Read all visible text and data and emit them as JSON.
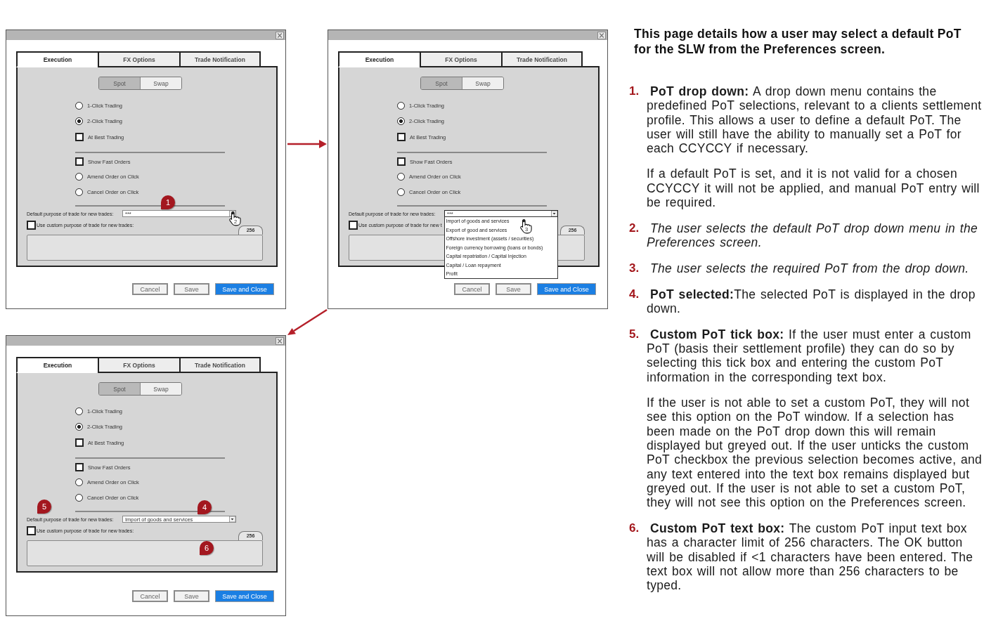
{
  "dialogs": [
    {
      "tabs": [
        {
          "label": "Execution",
          "selected": true
        },
        {
          "label": "FX Options",
          "selected": false
        },
        {
          "label": "Trade Notification",
          "selected": false
        }
      ],
      "segments": [
        {
          "label": "Spot",
          "selected": true
        },
        {
          "label": "Swap",
          "selected": false
        }
      ],
      "option_groups": [
        [
          {
            "kind": "radio",
            "label": "1-Click Trading",
            "checked": false
          },
          {
            "kind": "radio",
            "label": "2-Click Trading",
            "checked": true
          },
          {
            "kind": "checkbox",
            "label": "At Best Trading",
            "checked": false
          }
        ],
        [
          {
            "kind": "checkbox",
            "label": "Show Fast Orders",
            "checked": false
          },
          {
            "kind": "radio",
            "label": "Amend Order on Click",
            "checked": false
          },
          {
            "kind": "radio",
            "label": "Cancel Order on Click",
            "checked": false
          }
        ]
      ],
      "purpose": {
        "label": "Default purpose of trade for new trades:",
        "value": "***",
        "open": false
      },
      "custom": {
        "label": "Use custom purpose of trade for new trades:",
        "checked": false
      },
      "counter": "256",
      "buttons": [
        {
          "label": "Cancel",
          "kind": "secondary"
        },
        {
          "label": "Save",
          "kind": "secondary"
        },
        {
          "label": "Save and Close",
          "kind": "primary"
        }
      ],
      "markers": [
        "1"
      ],
      "cursor_step": "2"
    },
    {
      "tabs": [
        {
          "label": "Execution",
          "selected": true
        },
        {
          "label": "FX Options",
          "selected": false
        },
        {
          "label": "Trade Notification",
          "selected": false
        }
      ],
      "segments": [
        {
          "label": "Spot",
          "selected": true
        },
        {
          "label": "Swap",
          "selected": false
        }
      ],
      "option_groups": [
        [
          {
            "kind": "radio",
            "label": "1-Click Trading",
            "checked": false
          },
          {
            "kind": "radio",
            "label": "2-Click Trading",
            "checked": true
          },
          {
            "kind": "checkbox",
            "label": "At Best Trading",
            "checked": false
          }
        ],
        [
          {
            "kind": "checkbox",
            "label": "Show Fast Orders",
            "checked": false
          },
          {
            "kind": "radio",
            "label": "Amend Order on Click",
            "checked": false
          },
          {
            "kind": "radio",
            "label": "Cancel Order on Click",
            "checked": false
          }
        ]
      ],
      "purpose": {
        "label": "Default purpose of trade for new trades:",
        "value": "***",
        "open": true,
        "menu": [
          {
            "label": "Import of goods and services",
            "selected": false
          },
          {
            "label": "Export of good and services",
            "selected": false
          },
          {
            "label": "Offshore investment (assets / securities)",
            "selected": false
          },
          {
            "label": "Foreign currency borrowing (loans or bonds)",
            "selected": false
          },
          {
            "label": "Capital repatriation / Capital Injection",
            "selected": false
          },
          {
            "label": "Capital / Loan repayment",
            "selected": false
          },
          {
            "label": "Profit",
            "selected": false
          }
        ]
      },
      "custom": {
        "label": "Use custom purpose of trade for new t",
        "checked": false
      },
      "counter": "256",
      "buttons": [
        {
          "label": "Cancel",
          "kind": "secondary"
        },
        {
          "label": "Save",
          "kind": "secondary"
        },
        {
          "label": "Save and Close",
          "kind": "primary"
        }
      ],
      "cursor_step": "3"
    },
    {
      "tabs": [
        {
          "label": "Execution",
          "selected": true
        },
        {
          "label": "FX Options",
          "selected": false
        },
        {
          "label": "Trade Notification",
          "selected": false
        }
      ],
      "segments": [
        {
          "label": "Spot",
          "selected": true
        },
        {
          "label": "Swap",
          "selected": false
        }
      ],
      "option_groups": [
        [
          {
            "kind": "radio",
            "label": "1-Click Trading",
            "checked": false
          },
          {
            "kind": "radio",
            "label": "2-Click Trading",
            "checked": true
          },
          {
            "kind": "checkbox",
            "label": "At Best Trading",
            "checked": false
          }
        ],
        [
          {
            "kind": "checkbox",
            "label": "Show Fast Orders",
            "checked": false
          },
          {
            "kind": "radio",
            "label": "Amend Order on Click",
            "checked": false
          },
          {
            "kind": "radio",
            "label": "Cancel Order on Click",
            "checked": false
          }
        ]
      ],
      "purpose": {
        "label": "Default purpose of trade for new trades:",
        "value": "Import of goods and services",
        "open": false
      },
      "custom": {
        "label": "Use custom purpose of trade for new trades:",
        "checked": false
      },
      "counter": "256",
      "buttons": [
        {
          "label": "Cancel",
          "kind": "secondary"
        },
        {
          "label": "Save",
          "kind": "secondary"
        },
        {
          "label": "Save and Close",
          "kind": "primary"
        }
      ],
      "markers": [
        "4",
        "5",
        "6"
      ]
    }
  ],
  "notes": {
    "heading": "This page details how a user may select a default PoT for the SLW from the Preferences screen.",
    "steps": [
      {
        "number": "1.",
        "italic": false,
        "paragraphs": [
          "**PoT drop down:** A drop down menu contains the predefined PoT selections, relevant to a clients settlement profile. This allows a user to define a default PoT. The user will still have the ability to manually set a PoT for each CCYCCY if necessary.",
          "If a default PoT is set, and it is not valid for a chosen CCYCCY it will not be applied, and manual PoT entry will be required."
        ]
      },
      {
        "number": "2.",
        "italic": true,
        "paragraphs": [
          "The user selects the default PoT drop down menu in the Preferences screen."
        ]
      },
      {
        "number": "3.",
        "italic": true,
        "paragraphs": [
          "The user selects the required PoT from the drop down."
        ]
      },
      {
        "number": "4.",
        "italic": false,
        "paragraphs": [
          "**PoT selected:**The selected PoT is displayed in the drop down."
        ]
      },
      {
        "number": "5.",
        "italic": false,
        "paragraphs": [
          "**Custom PoT tick box:** If the user must enter a custom PoT (basis their settlement profile) they can do so by selecting this tick box and entering the custom PoT information in the corresponding text box.",
          "If the user is not able to set a custom PoT, they will not see this option on the PoT window. If a selection has been made on the PoT drop down this will remain displayed but greyed out. If the user unticks the custom PoT checkbox the previous selection becomes active, and any text entered into the text box remains displayed but greyed out. If the user is not able to set a custom PoT, they will not see this option on the Preferences screen."
        ]
      },
      {
        "number": "6.",
        "italic": false,
        "paragraphs": [
          "**Custom PoT text box:** The custom PoT input text box has a character limit of 256 characters. The OK button will be disabled if <1 characters have been entered. The text box will not allow more than 256 characters to be typed."
        ]
      }
    ]
  }
}
